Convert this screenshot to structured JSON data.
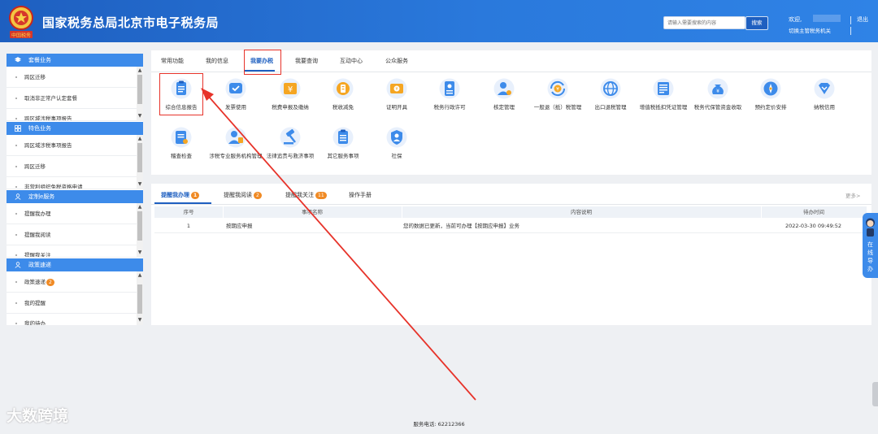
{
  "header": {
    "title": "国家税务总局北京市电子税务局",
    "emblem_caption": "中国税务",
    "search_placeholder": "请输入需要搜索的内容",
    "search_button": "搜索",
    "welcome": "欢迎,",
    "switch_org": "切换主管税务机关",
    "logout": "退出"
  },
  "sidebar": {
    "sections": [
      {
        "title": "套餐业务",
        "icon": "layers-icon",
        "items": [
          "跨区迁移",
          "取消非正常户认定套餐",
          "跨区域涉税事项报告"
        ]
      },
      {
        "title": "特色业务",
        "icon": "grid-icon",
        "items": [
          "跨区域涉税事项报告",
          "跨区迁移",
          "非营利组织免税资格申请"
        ]
      },
      {
        "title": "定制e服务",
        "icon": "user-icon",
        "items": [
          "提醒我办理",
          "提醒我阅读",
          "提醒我关注"
        ]
      },
      {
        "title": "政策速递",
        "icon": "user-icon",
        "items": [
          "政策速递",
          "我的提醒",
          "我的待办"
        ],
        "badge": "2"
      }
    ]
  },
  "tabs": [
    "常用功能",
    "我的信息",
    "我要办税",
    "我要查询",
    "互动中心",
    "公众服务"
  ],
  "active_tab_index": 2,
  "services": [
    {
      "label": "综合信息报告",
      "icon": "clipboard-icon"
    },
    {
      "label": "发票使用",
      "icon": "invoice-icon"
    },
    {
      "label": "税费申报及缴纳",
      "icon": "yuan-icon"
    },
    {
      "label": "税收减免",
      "icon": "tax-relief-icon"
    },
    {
      "label": "证明开具",
      "icon": "certificate-icon"
    },
    {
      "label": "税务行政许可",
      "icon": "permit-icon"
    },
    {
      "label": "核定管理",
      "icon": "user-gear-icon"
    },
    {
      "label": "一般退（抵）税管理",
      "icon": "refund-icon"
    },
    {
      "label": "出口退税管理",
      "icon": "globe-icon"
    },
    {
      "label": "增值税抵扣凭证管理",
      "icon": "voucher-icon"
    },
    {
      "label": "税务代保管资金收取",
      "icon": "money-bag-icon"
    },
    {
      "label": "预约定价安排",
      "icon": "compass-icon"
    },
    {
      "label": "纳税信用",
      "icon": "credit-icon"
    },
    {
      "label": "稽查检查",
      "icon": "inspection-icon"
    },
    {
      "label": "涉税专业服务机构管理",
      "icon": "agency-icon"
    },
    {
      "label": "法律追责与救济事项",
      "icon": "gavel-icon"
    },
    {
      "label": "其它服务事项",
      "icon": "other-services-icon"
    },
    {
      "label": "社保",
      "icon": "social-security-icon"
    }
  ],
  "reminders": {
    "tabs": [
      {
        "label": "提醒我办理",
        "count": "1"
      },
      {
        "label": "提醒我阅读",
        "count": "2"
      },
      {
        "label": "提醒我关注",
        "count": "11"
      },
      {
        "label": "操作手册",
        "count": ""
      }
    ],
    "more": "更多>",
    "columns": [
      "序号",
      "事项名称",
      "内容说明",
      "待办时间"
    ],
    "rows": [
      {
        "no": "1",
        "name": "按期应申报",
        "desc": "您的数据已更新，当前可办理【按期应申报】业务",
        "time": "2022-03-30 09:49:52"
      }
    ]
  },
  "online_guide": {
    "text": "在线导办"
  },
  "footer": {
    "phone": "服务电话: 62212366"
  },
  "watermark": "大数跨境",
  "colors": {
    "primary": "#1e5fc0",
    "accent_blue": "#3d8bea",
    "highlight": "#e7332a",
    "badge": "#f08a24"
  }
}
